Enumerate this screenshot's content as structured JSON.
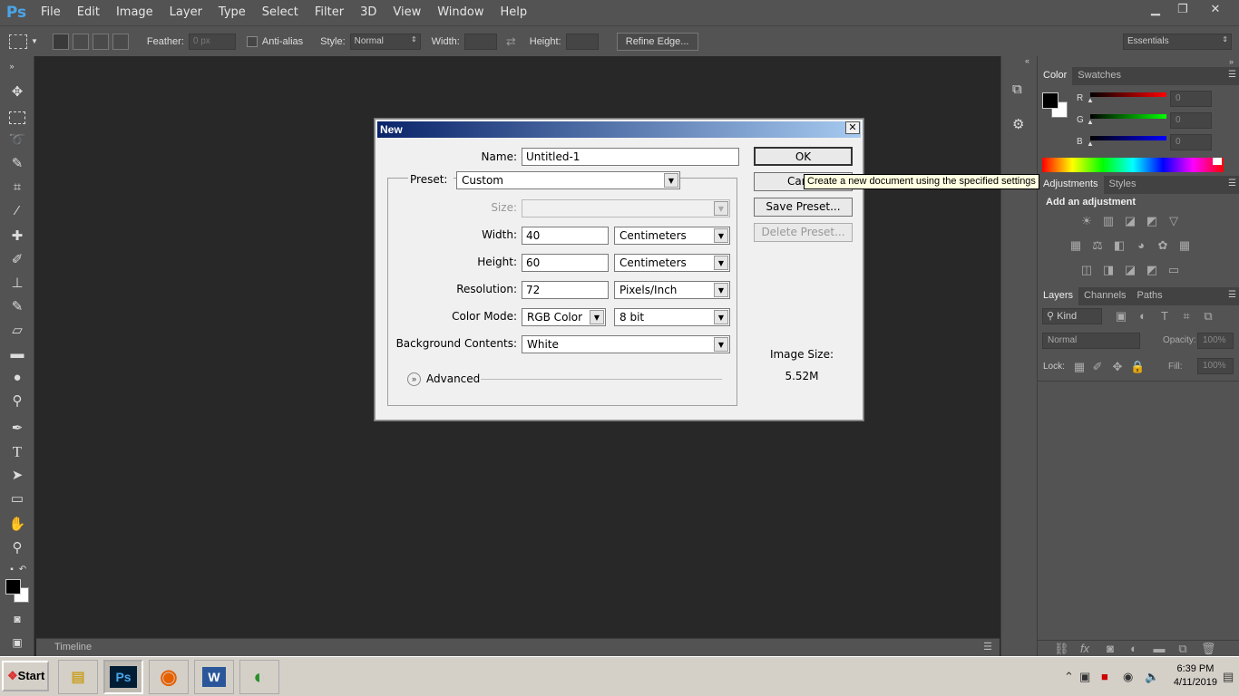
{
  "app": {
    "logo": "Ps"
  },
  "menu": [
    "File",
    "Edit",
    "Image",
    "Layer",
    "Type",
    "Select",
    "Filter",
    "3D",
    "View",
    "Window",
    "Help"
  ],
  "window_controls": {
    "minimize": "▁",
    "restore": "❐",
    "close": "✕"
  },
  "options": {
    "feather_label": "Feather:",
    "feather_value": "0 px",
    "antialias_label": "Anti-alias",
    "style_label": "Style:",
    "style_value": "Normal",
    "width_label": "Width:",
    "height_label": "Height:",
    "refine_edge": "Refine Edge...",
    "workspace": "Essentials"
  },
  "timeline": {
    "label": "Timeline"
  },
  "color_panel": {
    "tabs": [
      "Color",
      "Swatches"
    ],
    "r_label": "R",
    "g_label": "G",
    "b_label": "B",
    "r_value": "0",
    "g_value": "0",
    "b_value": "0"
  },
  "adjustments_panel": {
    "tabs": [
      "Adjustments",
      "Styles"
    ],
    "title": "Add an adjustment"
  },
  "layers_panel": {
    "tabs": [
      "Layers",
      "Channels",
      "Paths"
    ],
    "kind": "Kind",
    "blend": "Normal",
    "opacity_label": "Opacity:",
    "opacity_value": "100%",
    "lock_label": "Lock:",
    "fill_label": "Fill:",
    "fill_value": "100%"
  },
  "dialog": {
    "title": "New",
    "name_label": "Name:",
    "name_value": "Untitled-1",
    "preset_label": "Preset:",
    "preset_value": "Custom",
    "size_label": "Size:",
    "width_label": "Width:",
    "width_value": "40",
    "width_unit": "Centimeters",
    "height_label": "Height:",
    "height_value": "60",
    "height_unit": "Centimeters",
    "resolution_label": "Resolution:",
    "resolution_value": "72",
    "resolution_unit": "Pixels/Inch",
    "color_mode_label": "Color Mode:",
    "color_mode_value": "RGB Color",
    "bit_depth": "8 bit",
    "background_label": "Background Contents:",
    "background_value": "White",
    "advanced_label": "Advanced",
    "ok": "OK",
    "cancel": "Car",
    "save_preset": "Save Preset...",
    "delete_preset": "Delete Preset...",
    "image_size_label": "Image Size:",
    "image_size_value": "5.52M",
    "tooltip": "Create a new document using the specified settings"
  },
  "taskbar": {
    "start": "Start",
    "time": "6:39 PM",
    "date": "4/11/2019"
  },
  "colors": {
    "ps_blue": "#4aa4e8",
    "panel": "#535353",
    "canvas": "#282828",
    "dialog_title_start": "#0a246a",
    "dialog_title_end": "#a6caf0"
  }
}
